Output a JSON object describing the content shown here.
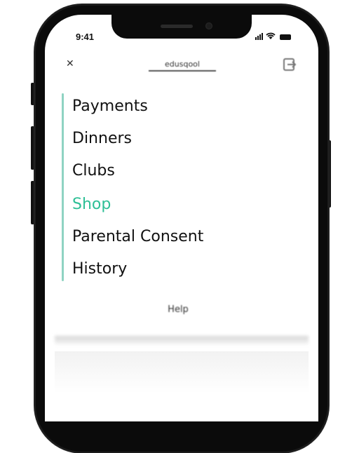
{
  "status_bar": {
    "time": "9:41"
  },
  "header": {
    "title": "edusqool",
    "close_icon": "close-icon",
    "logout_icon": "logout-icon"
  },
  "menu": {
    "items": [
      {
        "label": "Payments",
        "active": false
      },
      {
        "label": "Dinners",
        "active": false
      },
      {
        "label": "Clubs",
        "active": false
      },
      {
        "label": "Shop",
        "active": true
      },
      {
        "label": "Parental Consent",
        "active": false
      },
      {
        "label": "History",
        "active": false
      }
    ]
  },
  "footer": {
    "help_label": "Help"
  },
  "colors": {
    "accent": "#2ebf96",
    "rail": "#8fd3c2",
    "text": "#111111"
  }
}
